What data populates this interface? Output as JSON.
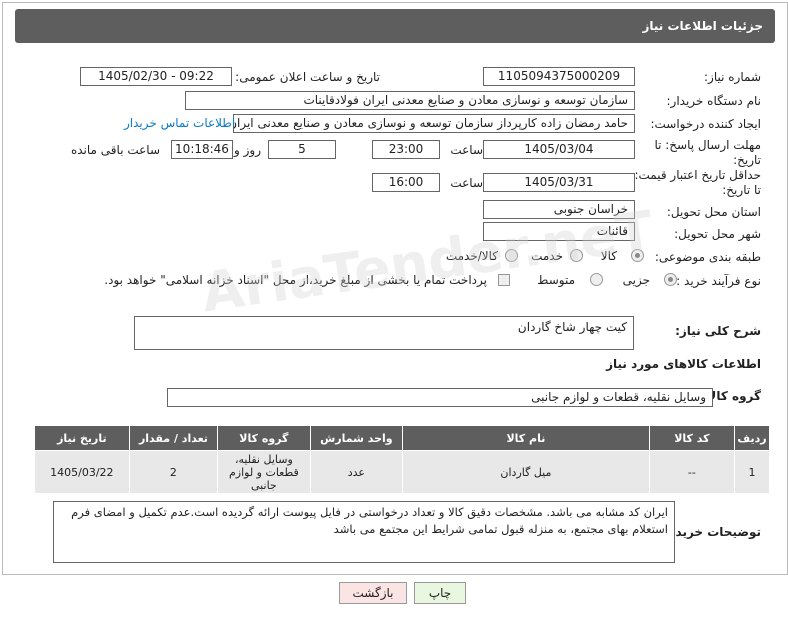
{
  "header": {
    "title": "جزئیات اطلاعات نیاز"
  },
  "fields": {
    "need_number_label": "شماره نیاز:",
    "need_number": "1105094375000209",
    "announce_label": "تاریخ و ساعت اعلان عمومی:",
    "announce_value": "1405/02/30 - 09:22",
    "buyer_org_label": "نام دستگاه خریدار:",
    "buyer_org": "سازمان توسعه و نوسازی معادن و صنایع معدنی ایران فولادقاینات",
    "creator_label": "ایجاد کننده درخواست:",
    "creator": "حامد  رمضان زاده  کارپرداز  سازمان توسعه و نوسازی معادن و صنایع معدنی ایران",
    "contact_link": "اطلاعات تماس خریدار",
    "deadline_label_1": "مهلت ارسال پاسخ: تا",
    "deadline_label_2": "تاریخ:",
    "deadline_date": "1405/03/04",
    "hour_label": "ساعت",
    "deadline_time": "23:00",
    "days_value": "5",
    "days_label": "روز و",
    "remaining_time": "10:18:46",
    "remaining_label": "ساعت باقی مانده",
    "validity_label_1": "حداقل تاریخ اعتبار قیمت:",
    "validity_label_2": "تا تاریخ:",
    "validity_date": "1405/03/31",
    "validity_time": "16:00",
    "province_label": "استان محل تحویل:",
    "province": "خراسان جنوبی",
    "city_label": "شهر محل تحویل:",
    "city": "قائنات",
    "category_label": "طبقه بندی موضوعی:",
    "category_options": [
      "کالا",
      "خدمت",
      "کالا/خدمت"
    ],
    "process_label": "نوع فرآیند خرید :",
    "process_options": [
      "جزیی",
      "متوسط"
    ],
    "payment_note": "پرداخت تمام یا بخشی از مبلغ خرید،از محل \"اسناد خزانه اسلامی\" خواهد بود.",
    "description_label": "شرح کلی نیاز:",
    "description": "کیت چهار شاخ گاردان",
    "goods_info_title": "اطلاعات کالاهای مورد نیاز",
    "goods_group_label": "گروه کالا:",
    "goods_group": "وسایل نقلیه، قطعات و لوازم جانبی"
  },
  "table": {
    "headers": [
      "ردیف",
      "کد کالا",
      "نام کالا",
      "واحد شمارش",
      "گروه کالا",
      "تعداد / مقدار",
      "تاریخ نیاز"
    ],
    "rows": [
      {
        "row": "1",
        "code": "--",
        "name": "میل گاردان",
        "unit": "عدد",
        "group": "وسایل نقلیه، قطعات و لوازم جانبی",
        "qty": "2",
        "date": "1405/03/22"
      }
    ]
  },
  "buyer_notes_label": "توضیحات خریدار:",
  "buyer_notes": "ایران کد مشابه می باشد. مشخصات دقیق کالا و تعداد درخواستی در فایل پیوست ارائه گردیده است.عدم تکمیل و امضای فرم استعلام بهای مجتمع، به منزله قبول تمامی شرایط این مجتمع می باشد",
  "buttons": {
    "print": "چاپ",
    "back": "بازگشت"
  },
  "colors": {
    "header_bg": "#5e5e5e",
    "link": "#0a7ac9",
    "print_bg": "#e9f7e1",
    "back_bg": "#fbe4e4"
  }
}
